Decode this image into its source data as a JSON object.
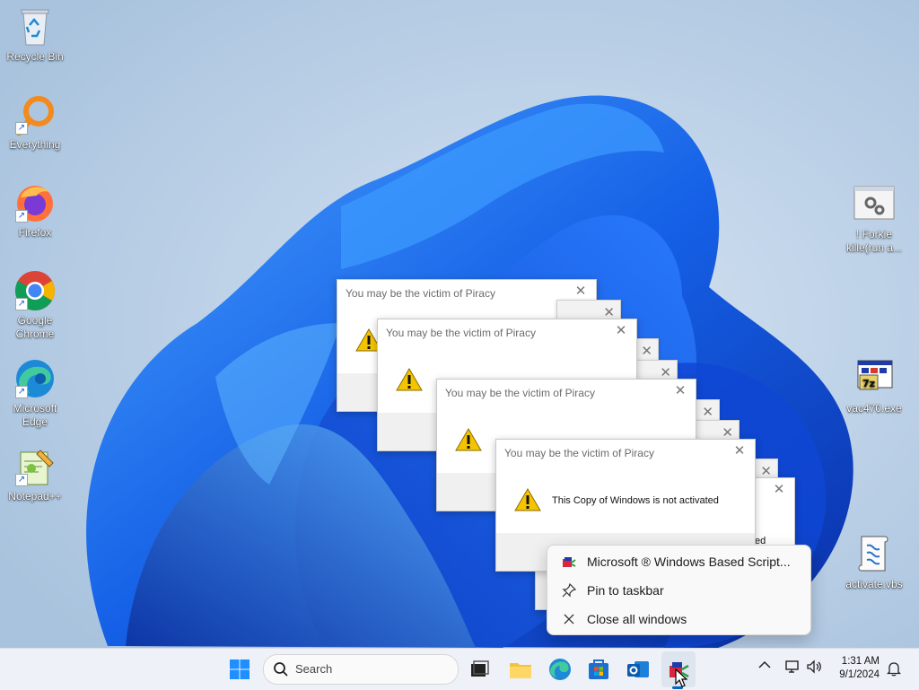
{
  "desktop_icons_left": [
    {
      "label": "Recycle Bin",
      "icon": "recycle-bin-icon"
    },
    {
      "label": "Everything",
      "icon": "everything-search-icon"
    },
    {
      "label": "Firefox",
      "icon": "firefox-icon"
    },
    {
      "label": "Google\nChrome",
      "icon": "chrome-icon"
    },
    {
      "label": "Microsoft\nEdge",
      "icon": "edge-icon"
    },
    {
      "label": "Notepad++",
      "icon": "notepadpp-icon"
    }
  ],
  "desktop_icons_right": [
    {
      "label": "! Forkie\nkille(run a...",
      "icon": "settings-app-icon"
    },
    {
      "label": "vac470.exe",
      "icon": "installer-icon"
    },
    {
      "label": "activate.vbs",
      "icon": "script-icon"
    }
  ],
  "dialog": {
    "title": "You may be the victim of Piracy",
    "message": "This Copy of Windows is not activated",
    "partial_text": "ed"
  },
  "context_menu": {
    "items": [
      {
        "label": "Microsoft ® Windows Based Script...",
        "icon": "wscript-icon"
      },
      {
        "label": "Pin to taskbar",
        "icon": "pin-icon"
      },
      {
        "label": "Close all windows",
        "icon": "close-icon"
      }
    ]
  },
  "taskbar": {
    "search_placeholder": "Search",
    "time": "1:31 AM",
    "date": "9/1/2024"
  },
  "colors": {
    "accent": "#0067c0",
    "warning": "#f5c400"
  }
}
